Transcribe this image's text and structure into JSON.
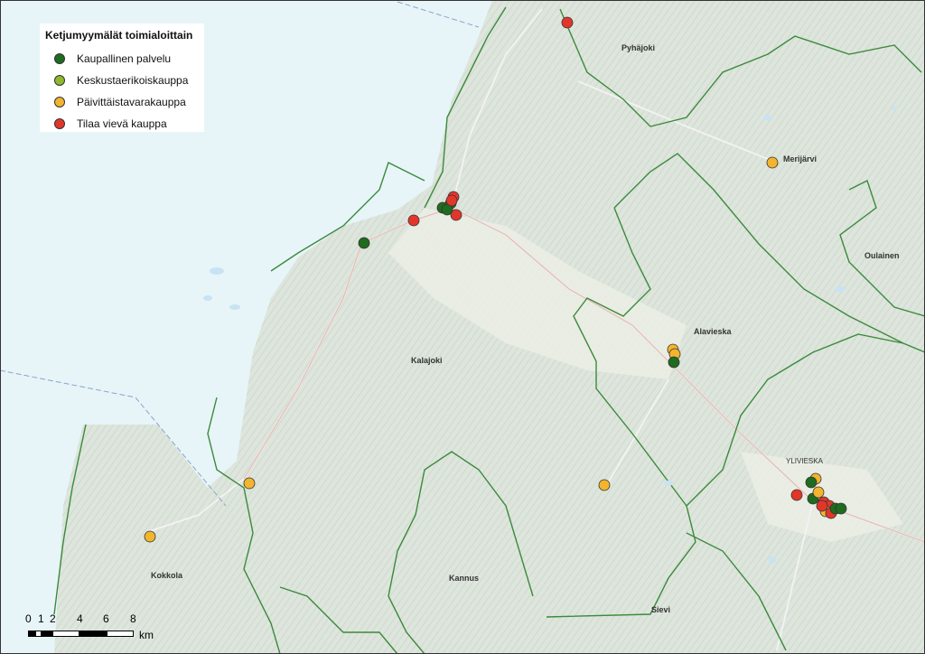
{
  "legend": {
    "title": "Ketjumyymälät toimialoittain",
    "items": [
      {
        "label": "Kaupallinen palvelu",
        "color": "#1f6b1f"
      },
      {
        "label": "Keskustaerikoiskauppa",
        "color": "#8fb92c"
      },
      {
        "label": "Päivittäistavarakauppa",
        "color": "#f3b42e"
      },
      {
        "label": "Tilaa vievä kauppa",
        "color": "#e3362a"
      }
    ]
  },
  "places": [
    {
      "name": "Pyhäjoki"
    },
    {
      "name": "Merijärvi"
    },
    {
      "name": "Oulainen"
    },
    {
      "name": "Alavieska"
    },
    {
      "name": "Kalajoki"
    },
    {
      "name": "Kannus"
    },
    {
      "name": "Kokkola"
    },
    {
      "name": "Sievi"
    },
    {
      "name": "YLIVIESKA"
    }
  ],
  "scale": {
    "ticks": [
      "0",
      "1",
      "2",
      "4",
      "6",
      "8"
    ],
    "unit": "km"
  }
}
